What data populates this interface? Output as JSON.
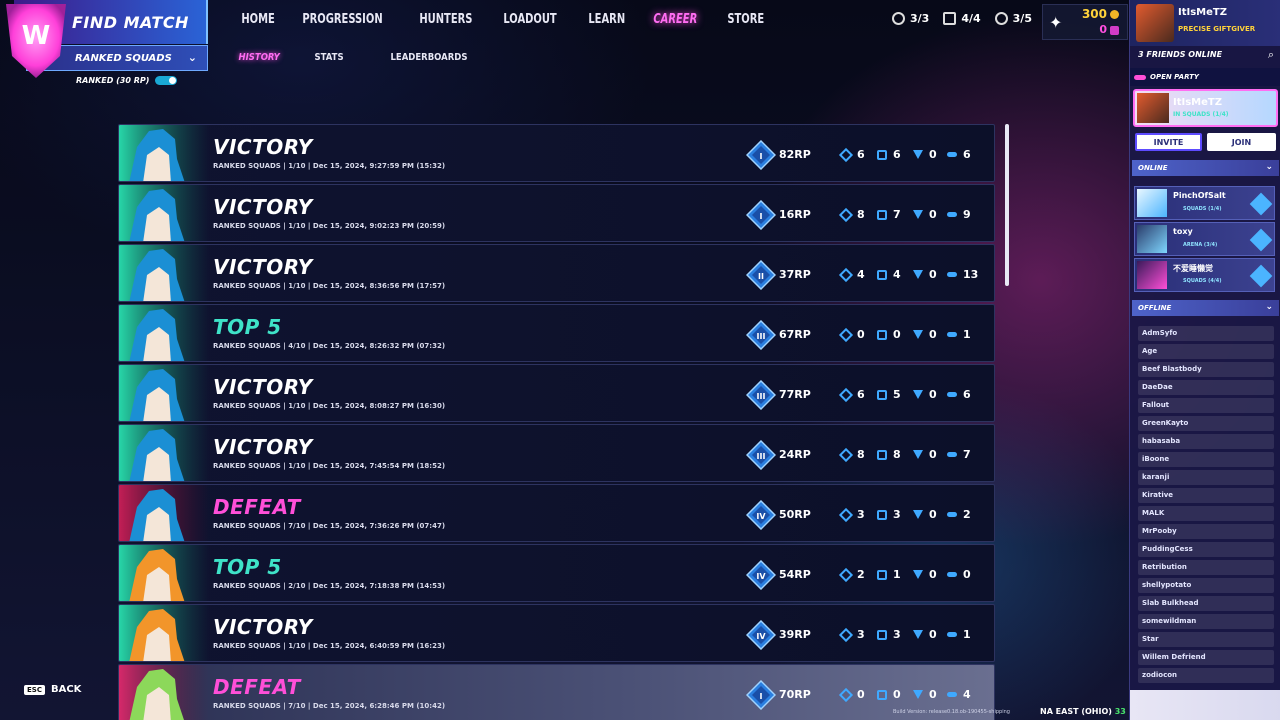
{
  "header": {
    "find_match": "FIND MATCH",
    "mode": "RANKED SQUADS",
    "ranked_label": "RANKED (30 RP)"
  },
  "nav": [
    "HOME",
    "PROGRESSION",
    "HUNTERS",
    "LOADOUT",
    "LEARN",
    "CAREER",
    "STORE"
  ],
  "subnav": [
    "HISTORY",
    "STATS",
    "LEADERBOARDS"
  ],
  "counters": [
    "3/3",
    "4/4",
    "3/5"
  ],
  "currency": {
    "gold": "300",
    "gems": "0"
  },
  "matches": [
    {
      "result": "VICTORY",
      "meta": "RANKED SQUADS | 1/10 | Dec 15, 2024, 9:27:59 PM (15:32)",
      "rank": "I",
      "rp": "82RP",
      "kills": "6",
      "assists": "6",
      "revives": "0",
      "damage": "6"
    },
    {
      "result": "VICTORY",
      "meta": "RANKED SQUADS | 1/10 | Dec 15, 2024, 9:02:23 PM (20:59)",
      "rank": "I",
      "rp": "16RP",
      "kills": "8",
      "assists": "7",
      "revives": "0",
      "damage": "9"
    },
    {
      "result": "VICTORY",
      "meta": "RANKED SQUADS | 1/10 | Dec 15, 2024, 8:36:56 PM (17:57)",
      "rank": "II",
      "rp": "37RP",
      "kills": "4",
      "assists": "4",
      "revives": "0",
      "damage": "13"
    },
    {
      "result": "TOP 5",
      "meta": "RANKED SQUADS | 4/10 | Dec 15, 2024, 8:26:32 PM (07:32)",
      "rank": "III",
      "rp": "67RP",
      "kills": "0",
      "assists": "0",
      "revives": "0",
      "damage": "1"
    },
    {
      "result": "VICTORY",
      "meta": "RANKED SQUADS | 1/10 | Dec 15, 2024, 8:08:27 PM (16:30)",
      "rank": "III",
      "rp": "77RP",
      "kills": "6",
      "assists": "5",
      "revives": "0",
      "damage": "6"
    },
    {
      "result": "VICTORY",
      "meta": "RANKED SQUADS | 1/10 | Dec 15, 2024, 7:45:54 PM (18:52)",
      "rank": "III",
      "rp": "24RP",
      "kills": "8",
      "assists": "8",
      "revives": "0",
      "damage": "7"
    },
    {
      "result": "DEFEAT",
      "meta": "RANKED SQUADS | 7/10 | Dec 15, 2024, 7:36:26 PM (07:47)",
      "rank": "IV",
      "rp": "50RP",
      "kills": "3",
      "assists": "3",
      "revives": "0",
      "damage": "2"
    },
    {
      "result": "TOP 5",
      "meta": "RANKED SQUADS | 2/10 | Dec 15, 2024, 7:18:38 PM (14:53)",
      "rank": "IV",
      "rp": "54RP",
      "kills": "2",
      "assists": "1",
      "revives": "0",
      "damage": "0"
    },
    {
      "result": "VICTORY",
      "meta": "RANKED SQUADS | 1/10 | Dec 15, 2024, 6:40:59 PM (16:23)",
      "rank": "IV",
      "rp": "39RP",
      "kills": "3",
      "assists": "3",
      "revives": "0",
      "damage": "1"
    },
    {
      "result": "DEFEAT",
      "meta": "RANKED SQUADS | 7/10 | Dec 15, 2024, 6:28:46 PM (10:42)",
      "rank": "I",
      "rp": "70RP",
      "kills": "0",
      "assists": "0",
      "revives": "0",
      "damage": "4"
    }
  ],
  "footer": {
    "back_key": "ESC",
    "back_label": "BACK",
    "build": "Build Version: release0.18.ob-190455-shipping",
    "region": "NA EAST (OHIO)",
    "ping": "33 ms"
  },
  "sidebar": {
    "username": "ItIsMeTZ",
    "user_title": "PRECISE GIFTGIVER",
    "friends_online": "3 FRIENDS ONLINE",
    "open_party": "OPEN PARTY",
    "party_member": "ItIsMeTZ",
    "party_status": "IN SQUADS (1/4)",
    "invite": "INVITE",
    "join": "JOIN",
    "online_label": "ONLINE",
    "offline_label": "OFFLINE",
    "online": [
      {
        "name": "PinchOfSalt",
        "mode": "SQUADS (1/4)"
      },
      {
        "name": "toxy",
        "mode": "ARENA (3/4)"
      },
      {
        "name": "不爱睡懒觉",
        "mode": "SQUADS (4/4)"
      }
    ],
    "offline": [
      "AdmSyfo",
      "Age",
      "Beef Blastbody",
      "DaeDae",
      "Fallout",
      "GreenKayto",
      "habasaba",
      "iBoone",
      "karanji",
      "Kirative",
      "MALK",
      "MrPooby",
      "PuddingCess",
      "Retribution",
      "shellypotato",
      "Slab Bulkhead",
      "somewildman",
      "Star",
      "Willem Defriend",
      "zodiocon"
    ]
  }
}
